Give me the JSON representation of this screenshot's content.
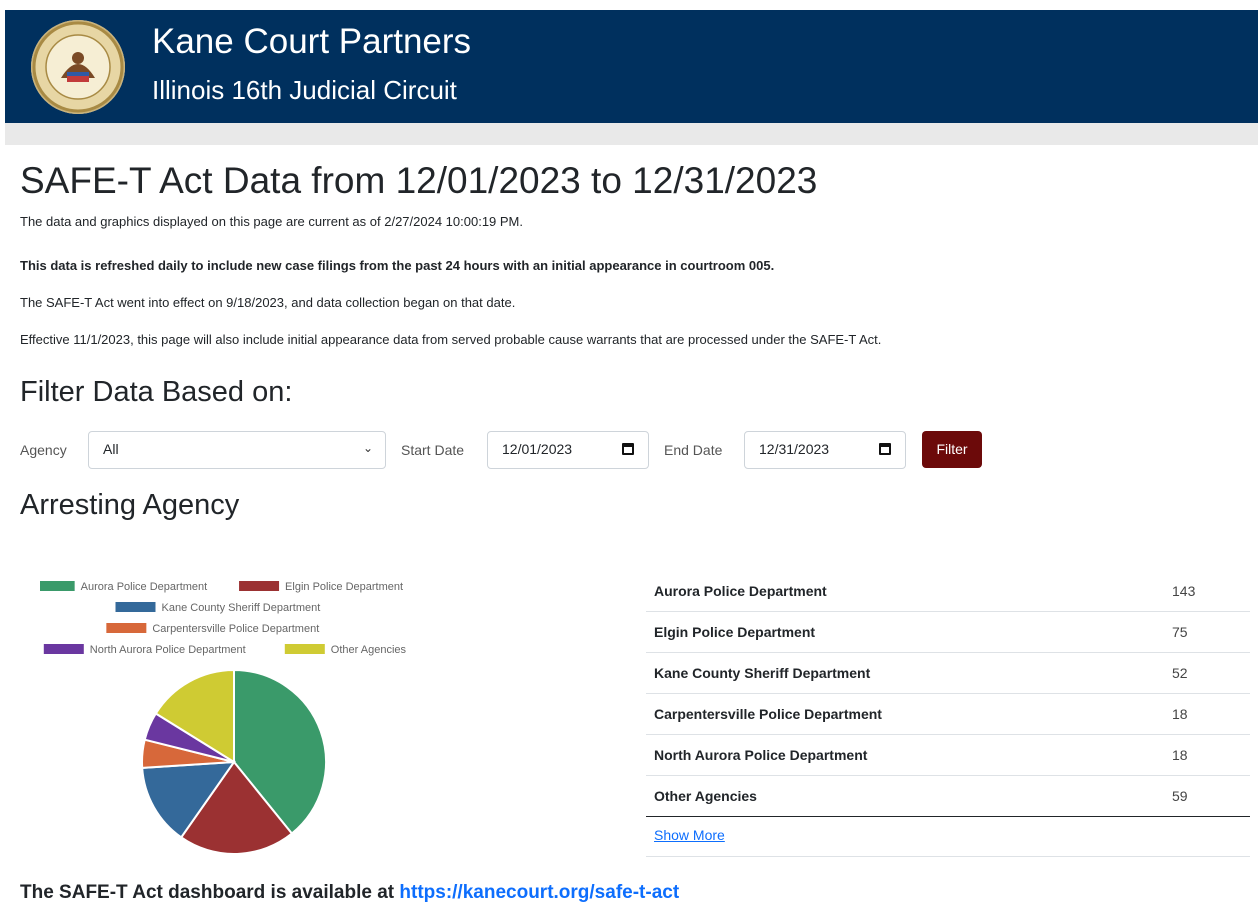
{
  "header": {
    "title": "Kane Court Partners",
    "subtitle": "Illinois 16th Judicial Circuit"
  },
  "page": {
    "title": "SAFE-T Act Data from 12/01/2023 to 12/31/2023",
    "current_as_of": "The data and graphics displayed on this page are current as of 2/27/2024 10:00:19 PM.",
    "refresh_note": "This data is refreshed daily to include new case filings from the past 24 hours with an initial appearance in courtroom 005.",
    "effect_note": "The SAFE-T Act went into effect on 9/18/2023, and data collection began on that date.",
    "warrants_note": "Effective 11/1/2023, this page will also include initial appearance data from served probable cause warrants that are processed under the SAFE-T Act."
  },
  "filter": {
    "heading": "Filter Data Based on:",
    "agency_label": "Agency",
    "agency_value": "All",
    "start_label": "Start Date",
    "start_value": "12/01/2023",
    "end_label": "End Date",
    "end_value": "12/31/2023",
    "button_label": "Filter"
  },
  "section": {
    "heading": "Arresting Agency",
    "show_more": "Show More"
  },
  "chart_data": {
    "type": "pie",
    "categories": [
      "Aurora Police Department",
      "Elgin Police Department",
      "Kane County Sheriff Department",
      "Carpentersville Police Department",
      "North Aurora Police Department",
      "Other Agencies"
    ],
    "values": [
      143,
      75,
      52,
      18,
      18,
      59
    ],
    "colors": [
      "#3a9a6a",
      "#9b3132",
      "#34699a",
      "#d7683a",
      "#6a37a0",
      "#cfcb33"
    ],
    "legend_position": "top"
  },
  "table": {
    "rows": [
      {
        "name": "Aurora Police Department",
        "count": "143"
      },
      {
        "name": "Elgin Police Department",
        "count": "75"
      },
      {
        "name": "Kane County Sheriff Department",
        "count": "52"
      },
      {
        "name": "Carpentersville Police Department",
        "count": "18"
      },
      {
        "name": "North Aurora Police Department",
        "count": "18"
      },
      {
        "name": "Other Agencies",
        "count": "59"
      }
    ]
  },
  "footer": {
    "prefix": "The SAFE-T Act dashboard is available at ",
    "link": "https://kanecourt.org/safe-t-act"
  },
  "icons": {
    "seal": "court-seal-icon",
    "dropdown": "chevron-down-icon",
    "calendar": "calendar-icon"
  }
}
